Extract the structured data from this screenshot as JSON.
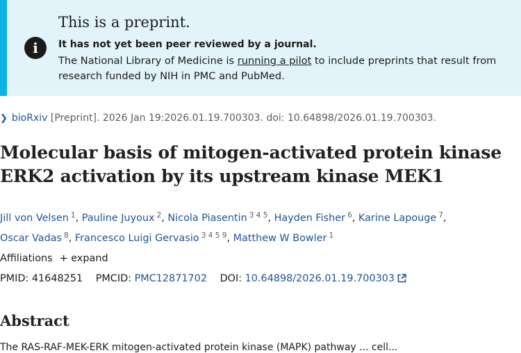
{
  "notice": {
    "icon": "info-icon",
    "title": "This is a preprint.",
    "bold": "It has not yet been peer reviewed by a journal.",
    "text_before": "The National Library of Medicine is ",
    "link": "running a pilot",
    "text_after": " to include preprints that result from research funded by NIH in PMC and PubMed."
  },
  "citation": {
    "journal": "bioRxiv",
    "details": " [Preprint]. 2026 Jan 19:2026.01.19.700303. doi: 10.64898/2026.01.19.700303."
  },
  "title": "Molecular basis of mitogen-activated protein kinase ERK2 activation by its upstream kinase MEK1",
  "authors": [
    {
      "name": "Jill von Velsen",
      "sup": "1"
    },
    {
      "name": "Pauline Juyoux",
      "sup": "2"
    },
    {
      "name": "Nicola Piasentin",
      "sup": "3 4 5"
    },
    {
      "name": "Hayden Fisher",
      "sup": "6"
    },
    {
      "name": "Karine Lapouge",
      "sup": "7"
    },
    {
      "name": "Oscar Vadas",
      "sup": "8"
    },
    {
      "name": "Francesco Luigi Gervasio",
      "sup": "3 4 5 9"
    },
    {
      "name": "Matthew W Bowler",
      "sup": "1"
    }
  ],
  "affiliations": {
    "label": "Affiliations",
    "expand": "+ expand"
  },
  "ids": {
    "pmid_label": "PMID:",
    "pmid": "41648251",
    "pmcid_label": "PMCID:",
    "pmcid": "PMC12871702",
    "doi_label": "DOI:",
    "doi": "10.64898/2026.01.19.700303"
  },
  "abstract": {
    "heading": "Abstract",
    "text": "The RAS-RAF-MEK-ERK mitogen-activated protein kinase (MAPK) pathway ... cell..."
  },
  "colors": {
    "accent": "#0eb1e6",
    "notice_bg": "#e2f4f9",
    "link": "#205493"
  }
}
